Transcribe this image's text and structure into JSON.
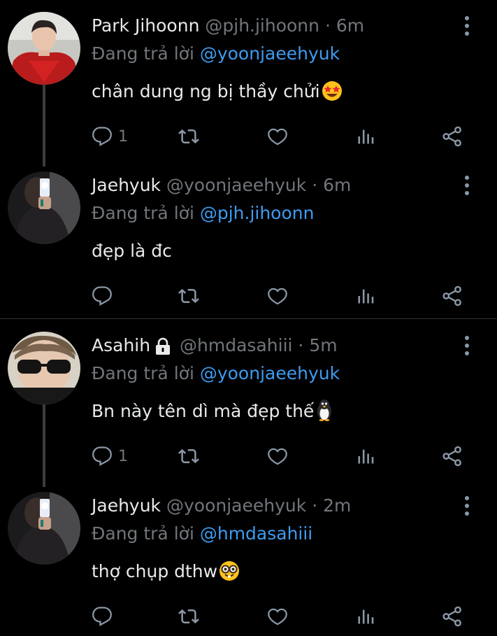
{
  "tweets": [
    {
      "name": "Park Jihoonn",
      "handle": "@pjh.jihoonn",
      "time": "6m",
      "reply_prefix": "Đang trả lời",
      "reply_to": "@yoonjaeehyuk",
      "text": "chân dung ng bị thầy chửi",
      "emoji": "star-struck-emoji",
      "reply_count": "1",
      "locked": false,
      "avatar": "avatar-red-jacket"
    },
    {
      "name": "Jaehyuk",
      "handle": "@yoonjaeehyuk",
      "time": "6m",
      "reply_prefix": "Đang trả lời",
      "reply_to": "@pjh.jihoonn",
      "text": "đẹp là đc",
      "emoji": "",
      "reply_count": "",
      "locked": false,
      "avatar": "avatar-mirror-selfie"
    },
    {
      "name": "Asahih",
      "handle": "@hmdasahiii",
      "time": "5m",
      "reply_prefix": "Đang trả lời",
      "reply_to": "@yoonjaeehyuk",
      "text": "Bn này tên dì mà đẹp thế",
      "emoji": "penguin-emoji",
      "reply_count": "1",
      "locked": true,
      "avatar": "avatar-sunglasses"
    },
    {
      "name": "Jaehyuk",
      "handle": "@yoonjaeehyuk",
      "time": "2m",
      "reply_prefix": "Đang trả lời",
      "reply_to": "@hmdasahiii",
      "text": "thợ chụp dthw",
      "emoji": "nerd-face-emoji",
      "reply_count": "",
      "locked": false,
      "avatar": "avatar-mirror-selfie"
    }
  ],
  "separator": "·",
  "colors": {
    "background": "#000000",
    "text": "#e7e9ea",
    "muted": "#71767b",
    "mention": "#3d9bf0",
    "thread_line": "#3a3d40"
  },
  "icons": [
    "reply-icon",
    "retweet-icon",
    "like-icon",
    "views-icon",
    "share-icon",
    "more-options-icon",
    "lock-icon"
  ]
}
